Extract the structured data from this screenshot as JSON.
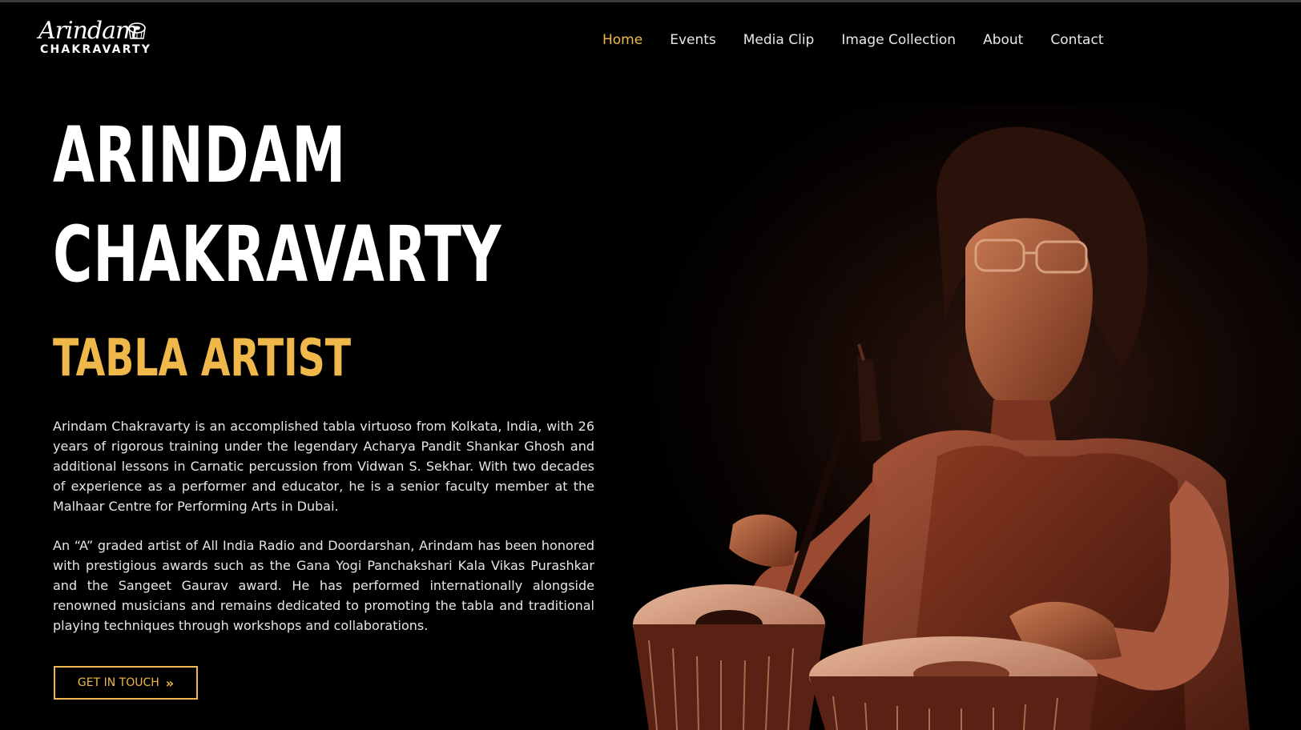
{
  "logo": {
    "script": "Arindam",
    "sub": "CHAKRAVARTY"
  },
  "nav": {
    "items": [
      {
        "label": "Home",
        "active": true
      },
      {
        "label": "Events",
        "active": false
      },
      {
        "label": "Media Clip",
        "active": false
      },
      {
        "label": "Image Collection",
        "active": false
      },
      {
        "label": "About",
        "active": false
      },
      {
        "label": "Contact",
        "active": false
      }
    ]
  },
  "hero": {
    "name_line_1": "ARINDAM",
    "name_line_2": "CHAKRAVARTY",
    "subtitle": "TABLA ARTIST",
    "bio_1": "Arindam Chakravarty is an accomplished tabla virtuoso from Kolkata, India, with 26 years of rigorous training under the legendary Acharya Pandit Shankar Ghosh and additional lessons in Carnatic percussion from Vidwan S. Sekhar. With two decades of experience as a performer and educator, he is a senior faculty member at the Malhaar Centre for Performing Arts in Dubai.",
    "bio_2": "An “A” graded artist of All India Radio and Doordarshan, Arindam has been honored with prestigious awards such as the Gana Yogi Panchakshari Kala Vikas Purashkar and the Sangeet Gaurav award. He has performed internationally alongside renowned musicians and remains dedicated to promoting the tabla and traditional playing techniques through workshops and collaborations.",
    "cta_label": "GET IN TOUCH",
    "cta_icon": "»"
  },
  "colors": {
    "accent": "#f0b84a",
    "background": "#000000",
    "text": "#ffffff"
  },
  "icons": {
    "logo_mark": "tabla-emblem-icon",
    "cta": "double-chevron-right-icon"
  }
}
